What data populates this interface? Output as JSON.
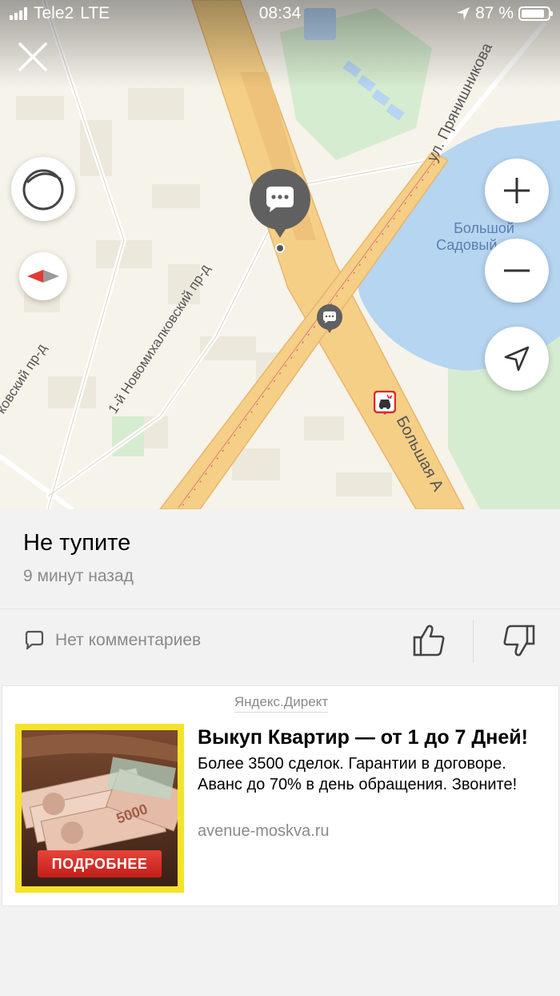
{
  "status_bar": {
    "carrier": "Tele2",
    "network": "LTE",
    "time": "08:34",
    "battery_text": "87 %",
    "battery_level": 0.87
  },
  "map": {
    "streets": {
      "pryanishnikova": "ул. Прянишникова",
      "novomikhalkovsky_1": "1-й Новомихалковский пр-д",
      "kovsky": "ковский пр-д",
      "bolshaya": "Большая А"
    },
    "pond": {
      "line1": "Большой",
      "line2": "Садовый пруд"
    },
    "icons": {
      "close": "close-icon",
      "compass": "compass-icon",
      "zoom_in": "plus-icon",
      "zoom_out": "minus-icon",
      "locate": "location-arrow-icon",
      "chat_pin": "chat-bubble-icon",
      "accident": "car-accident-icon"
    },
    "colors": {
      "road": "#f5cf86",
      "road_edge": "#e8b56c",
      "water": "#b6d5f1",
      "park": "#cfe9c6",
      "pin": "#606060"
    }
  },
  "event": {
    "title": "Не тупите",
    "time_ago": "9 минут назад",
    "comments_label": "Нет комментариев"
  },
  "ad": {
    "source": "Яндекс.Директ",
    "headline": "Выкуп Квартир — от 1 до 7 Дней!",
    "body": "Более 3500 сделок. Гарантии в договоре. Аванс до 70% в день обращения. Звоните!",
    "domain": "avenue-moskva.ru",
    "image_cta": "ПОДРОБНЕЕ",
    "banknote_value": "5000"
  }
}
